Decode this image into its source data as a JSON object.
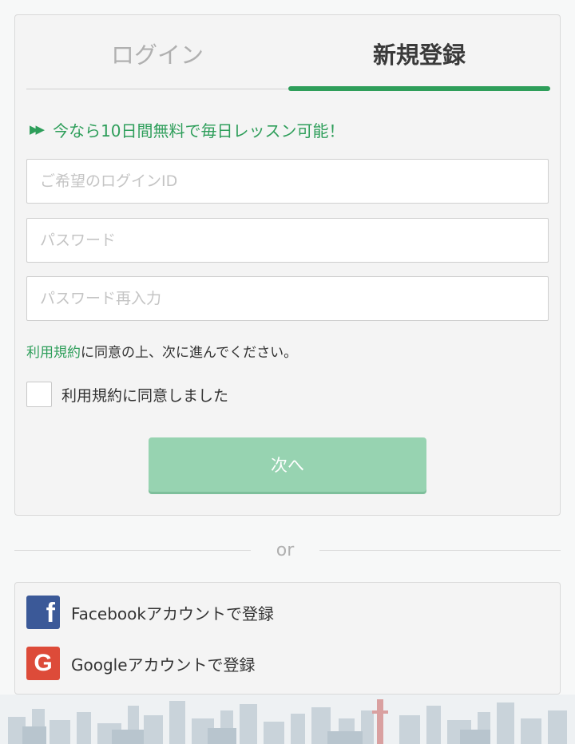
{
  "tabs": {
    "login": "ログイン",
    "register": "新規登録"
  },
  "promo": {
    "text": "今なら10日間無料で毎日レッスン可能！"
  },
  "form": {
    "login_id_placeholder": "ご希望のログインID",
    "password_placeholder": "パスワード",
    "password_confirm_placeholder": "パスワード再入力",
    "terms_link": "利用規約",
    "terms_note_rest": "に同意の上、次に進んでください。",
    "agree_label": "利用規約に同意しました",
    "agree_checked": false,
    "next_button": "次へ"
  },
  "divider": {
    "text": "or"
  },
  "social": {
    "facebook_label": "Facebookアカウントで登録",
    "google_label": "Googleアカウントで登録"
  },
  "icons": {
    "promo": "double-chevron-right-icon",
    "facebook": "facebook-icon",
    "google": "google-icon"
  },
  "colors": {
    "accent": "#2e9e5a",
    "button_disabled": "#97d3b1",
    "facebook": "#3b5998",
    "google": "#dd4b39"
  }
}
